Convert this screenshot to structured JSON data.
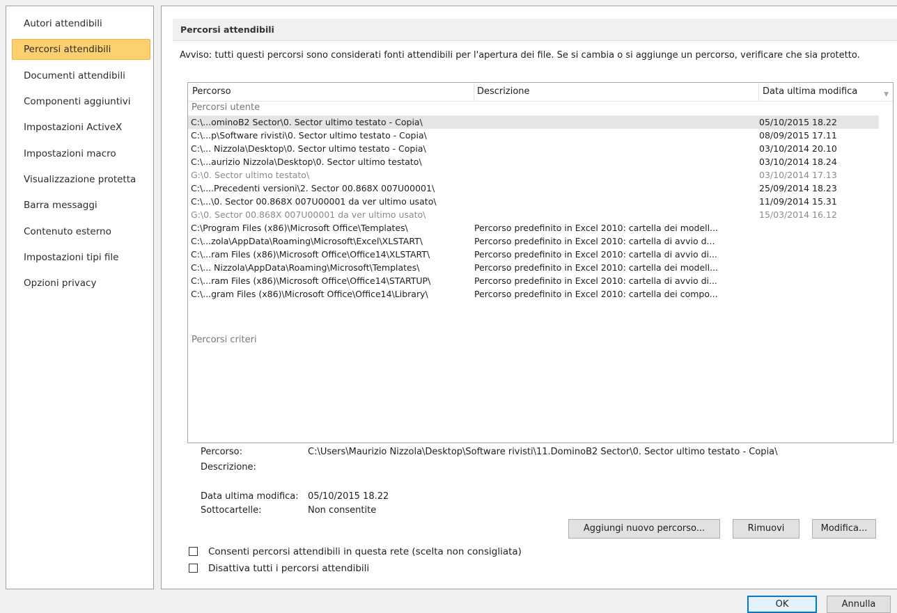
{
  "sidebar": {
    "items": [
      {
        "label": "Autori attendibili",
        "selected": false
      },
      {
        "label": "Percorsi attendibili",
        "selected": true
      },
      {
        "label": "Documenti attendibili",
        "selected": false
      },
      {
        "label": "Componenti aggiuntivi",
        "selected": false
      },
      {
        "label": "Impostazioni ActiveX",
        "selected": false
      },
      {
        "label": "Impostazioni macro",
        "selected": false
      },
      {
        "label": "Visualizzazione protetta",
        "selected": false
      },
      {
        "label": "Barra messaggi",
        "selected": false
      },
      {
        "label": "Contenuto esterno",
        "selected": false
      },
      {
        "label": "Impostazioni tipi file",
        "selected": false
      },
      {
        "label": "Opzioni privacy",
        "selected": false
      }
    ]
  },
  "main": {
    "title": "Percorsi attendibili",
    "warning": "Avviso: tutti questi percorsi sono considerati fonti attendibili per l'apertura dei file. Se si cambia o si aggiunge un percorso, verificare che sia protetto.",
    "columns": {
      "path": "Percorso",
      "description": "Descrizione",
      "date": "Data ultima modifica"
    },
    "user_group_label": "Percorsi utente",
    "user_rows": [
      {
        "path": "C:\\...ominoB2 Sector\\0. Sector  ultimo testato - Copia\\",
        "description": "",
        "date": "05/10/2015 18.22",
        "selected": true,
        "grey": false
      },
      {
        "path": "C:\\...p\\Software rivisti\\0. Sector  ultimo testato - Copia\\",
        "description": "",
        "date": "08/09/2015 17.11",
        "selected": false,
        "grey": false
      },
      {
        "path": "C:\\... Nizzola\\Desktop\\0. Sector  ultimo testato - Copia\\",
        "description": "",
        "date": "03/10/2014 20.10",
        "selected": false,
        "grey": false
      },
      {
        "path": "C:\\...aurizio Nizzola\\Desktop\\0. Sector  ultimo testato\\",
        "description": "",
        "date": "03/10/2014 18.24",
        "selected": false,
        "grey": false
      },
      {
        "path": "G:\\0. Sector  ultimo testato\\",
        "description": "",
        "date": "03/10/2014 17.13",
        "selected": false,
        "grey": true
      },
      {
        "path": "C:\\....Precedenti versioni\\2. Sector 00.868X 007U00001\\",
        "description": "",
        "date": "25/09/2014 18.23",
        "selected": false,
        "grey": false
      },
      {
        "path": "C:\\...\\0. Sector 00.868X 007U00001 da ver ultimo usato\\",
        "description": "",
        "date": "11/09/2014 15.31",
        "selected": false,
        "grey": false
      },
      {
        "path": "G:\\0. Sector 00.868X 007U00001 da ver ultimo usato\\",
        "description": "",
        "date": "15/03/2014 16.12",
        "selected": false,
        "grey": true
      },
      {
        "path": "C:\\Program Files (x86)\\Microsoft Office\\Templates\\",
        "description": "Percorso predefinito in Excel 2010: cartella dei modell...",
        "date": "",
        "selected": false,
        "grey": false
      },
      {
        "path": "C:\\...zola\\AppData\\Roaming\\Microsoft\\Excel\\XLSTART\\",
        "description": "Percorso predefinito in Excel 2010: cartella di avvio d...",
        "date": "",
        "selected": false,
        "grey": false
      },
      {
        "path": "C:\\...ram Files (x86)\\Microsoft Office\\Office14\\XLSTART\\",
        "description": "Percorso predefinito in Excel 2010: cartella di avvio di...",
        "date": "",
        "selected": false,
        "grey": false
      },
      {
        "path": "C:\\... Nizzola\\AppData\\Roaming\\Microsoft\\Templates\\",
        "description": "Percorso predefinito in Excel 2010: cartella dei modell...",
        "date": "",
        "selected": false,
        "grey": false
      },
      {
        "path": "C:\\...ram Files (x86)\\Microsoft Office\\Office14\\STARTUP\\",
        "description": "Percorso predefinito in Excel 2010: cartella di avvio di...",
        "date": "",
        "selected": false,
        "grey": false
      },
      {
        "path": "C:\\...gram Files (x86)\\Microsoft Office\\Office14\\Library\\",
        "description": "Percorso predefinito in Excel 2010: cartella dei compo...",
        "date": "",
        "selected": false,
        "grey": false
      }
    ],
    "policy_group_label": "Percorsi criteri",
    "details": {
      "path_label": "Percorso:",
      "path_value": "C:\\Users\\Maurizio Nizzola\\Desktop\\Software rivisti\\11.DominoB2 Sector\\0. Sector  ultimo testato - Copia\\",
      "description_label": "Descrizione:",
      "description_value": "",
      "date_label": "Data ultima modifica:",
      "date_value": "05/10/2015 18.22",
      "subfolders_label": "Sottocartelle:",
      "subfolders_value": "Non consentite"
    },
    "buttons": {
      "add": "Aggiungi nuovo percorso...",
      "remove": "Rimuovi",
      "modify": "Modifica..."
    },
    "checkboxes": [
      {
        "label": "Consenti percorsi attendibili in questa rete (scelta non consigliata)",
        "checked": false
      },
      {
        "label": "Disattiva tutti i percorsi attendibili",
        "checked": false
      }
    ]
  },
  "footer": {
    "ok": "OK",
    "cancel": "Annulla"
  }
}
